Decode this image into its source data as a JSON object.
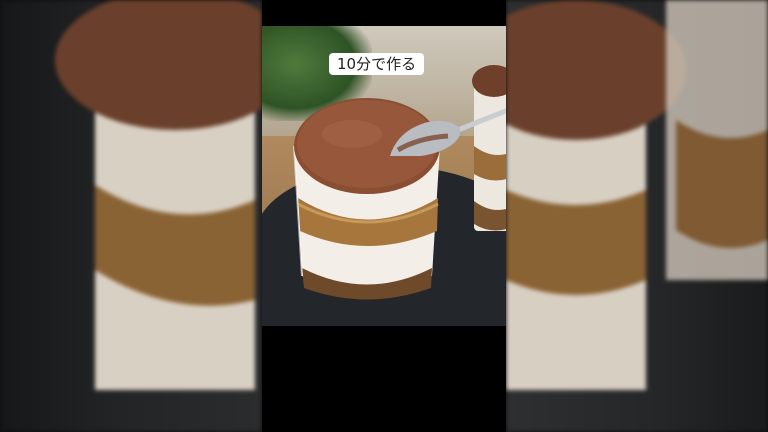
{
  "overlay": {
    "caption": "10分で作る"
  }
}
